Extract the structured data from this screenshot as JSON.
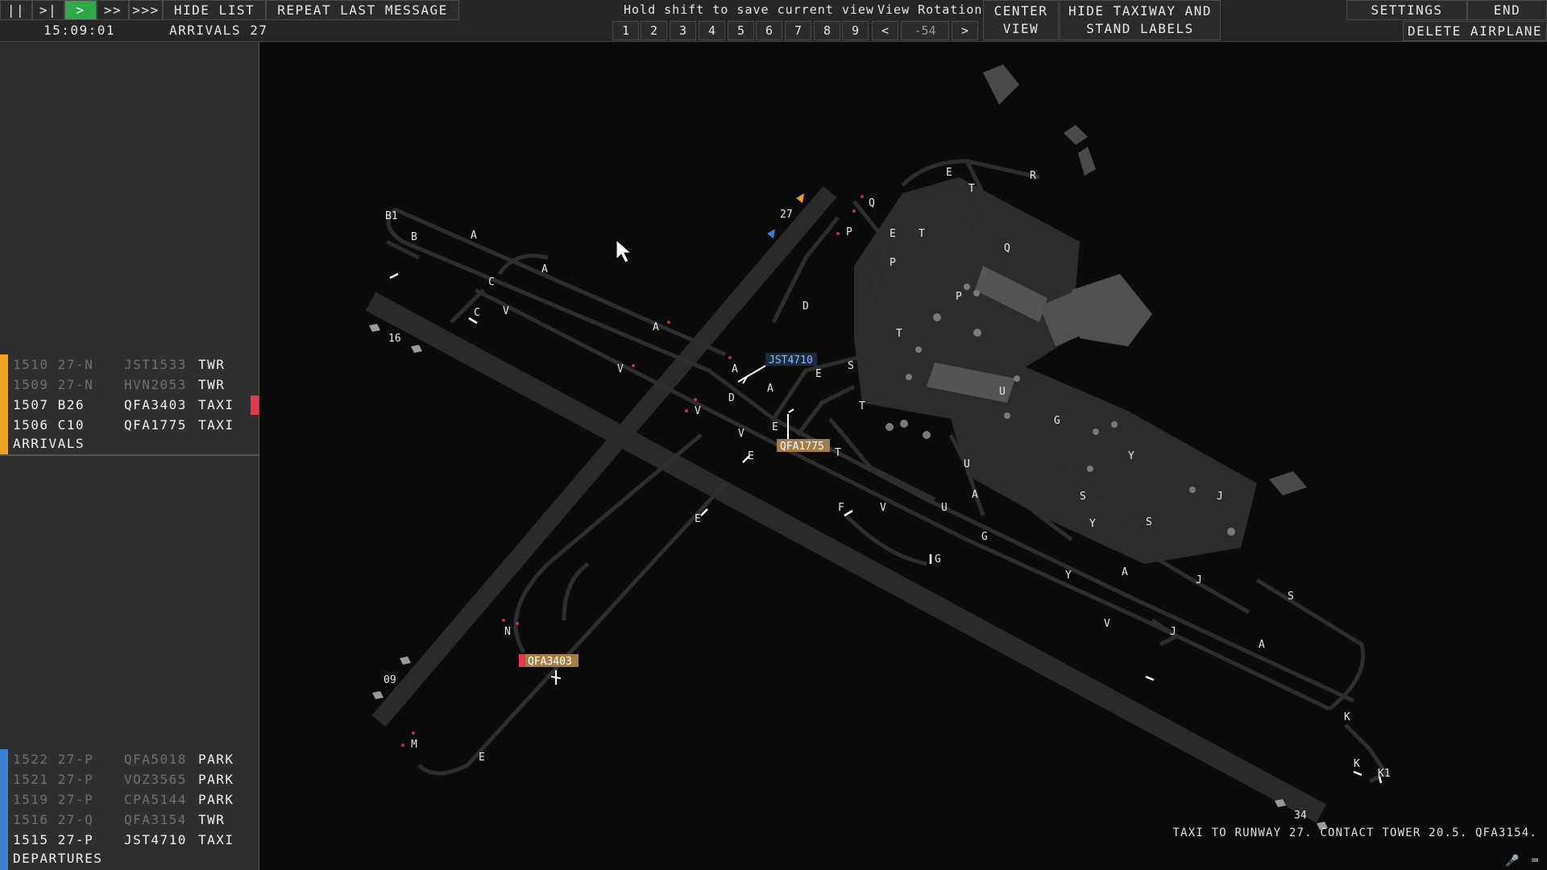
{
  "toolbar": {
    "pause_label": "||",
    "step_label": ">|",
    "play_label": ">",
    "fast_label": ">>",
    "faster_label": ">>>",
    "hide_list_label": "HIDE LIST",
    "repeat_label": "REPEAT LAST MESSAGE",
    "clock": "15:09:01",
    "arrivals_runway": "ARRIVALS 27",
    "save_view_hint": "Hold shift to save current view",
    "view_rotation_label": "View Rotation",
    "view_slots": [
      "1",
      "2",
      "3",
      "4",
      "5",
      "6",
      "7",
      "8",
      "9"
    ],
    "rotate_left": "<",
    "rotation_value": "-54",
    "rotate_right": ">",
    "center_view_line1": "CENTER",
    "center_view_line2": "VIEW",
    "hide_labels_line1": "HIDE TAXIWAY AND",
    "hide_labels_line2": "STAND LABELS",
    "settings_label": "SETTINGS",
    "end_label": "END",
    "delete_label": "DELETE AIRPLANE"
  },
  "arrivals": {
    "label": "ARRIVALS",
    "bar_color": "#f0a020",
    "strips": [
      {
        "time_pos": "1510 27-N",
        "callsign": "JST1533",
        "status": "TWR",
        "dim": true
      },
      {
        "time_pos": "1509 27-N",
        "callsign": "HVN2053",
        "status": "TWR",
        "dim": true
      },
      {
        "time_pos": "1507 B26",
        "callsign": "QFA3403",
        "status": "TAXI",
        "dim": false
      },
      {
        "time_pos": "1506 C10",
        "callsign": "QFA1775",
        "status": "TAXI",
        "dim": false
      }
    ]
  },
  "departures": {
    "label": "DEPARTURES",
    "bar_color": "#3a7fd0",
    "strips": [
      {
        "time_pos": "1522 27-P",
        "callsign": "QFA5018",
        "status": "PARK",
        "dim": true
      },
      {
        "time_pos": "1521 27-P",
        "callsign": "VOZ3565",
        "status": "PARK",
        "dim": true
      },
      {
        "time_pos": "1519 27-P",
        "callsign": "CPA5144",
        "status": "PARK",
        "dim": true
      },
      {
        "time_pos": "1516 27-Q",
        "callsign": "QFA3154",
        "status": "TWR",
        "dim": true
      },
      {
        "time_pos": "1515 27-P",
        "callsign": "JST4710",
        "status": "TAXI",
        "dim": false
      }
    ]
  },
  "map": {
    "runway_ends": [
      "27",
      "16",
      "09",
      "34"
    ],
    "taxiway_labels": [
      "B1",
      "B",
      "A",
      "A",
      "C",
      "C",
      "V",
      "A",
      "V",
      "V",
      "V",
      "E",
      "E",
      "N",
      "M",
      "E",
      "Q",
      "P",
      "E",
      "T",
      "P",
      "D",
      "S",
      "A",
      "A",
      "E",
      "E",
      "D",
      "T",
      "T",
      "F",
      "V",
      "G",
      "U",
      "U",
      "A",
      "G",
      "Y",
      "Y",
      "A",
      "J",
      "J",
      "V",
      "S",
      "A",
      "K",
      "K",
      "K1",
      "E",
      "T",
      "R",
      "Q",
      "P",
      "T",
      "U",
      "G",
      "S",
      "Y",
      "J",
      "S"
    ],
    "aircraft_tags": [
      {
        "callsign": "JST4710",
        "bg": "#1e2b3f",
        "fg": "#8fb6ff"
      },
      {
        "callsign": "QFA1775",
        "bg": "#a57d46",
        "fg": "#ffffff"
      },
      {
        "callsign": "QFA3403",
        "bg": "#a57d46",
        "fg": "#ffffff"
      }
    ]
  },
  "status_message": "TAXI TO RUNWAY 27. CONTACT TOWER 20.5. QFA3154.",
  "bottom_icons": [
    "microphone-icon",
    "keyboard-icon"
  ]
}
